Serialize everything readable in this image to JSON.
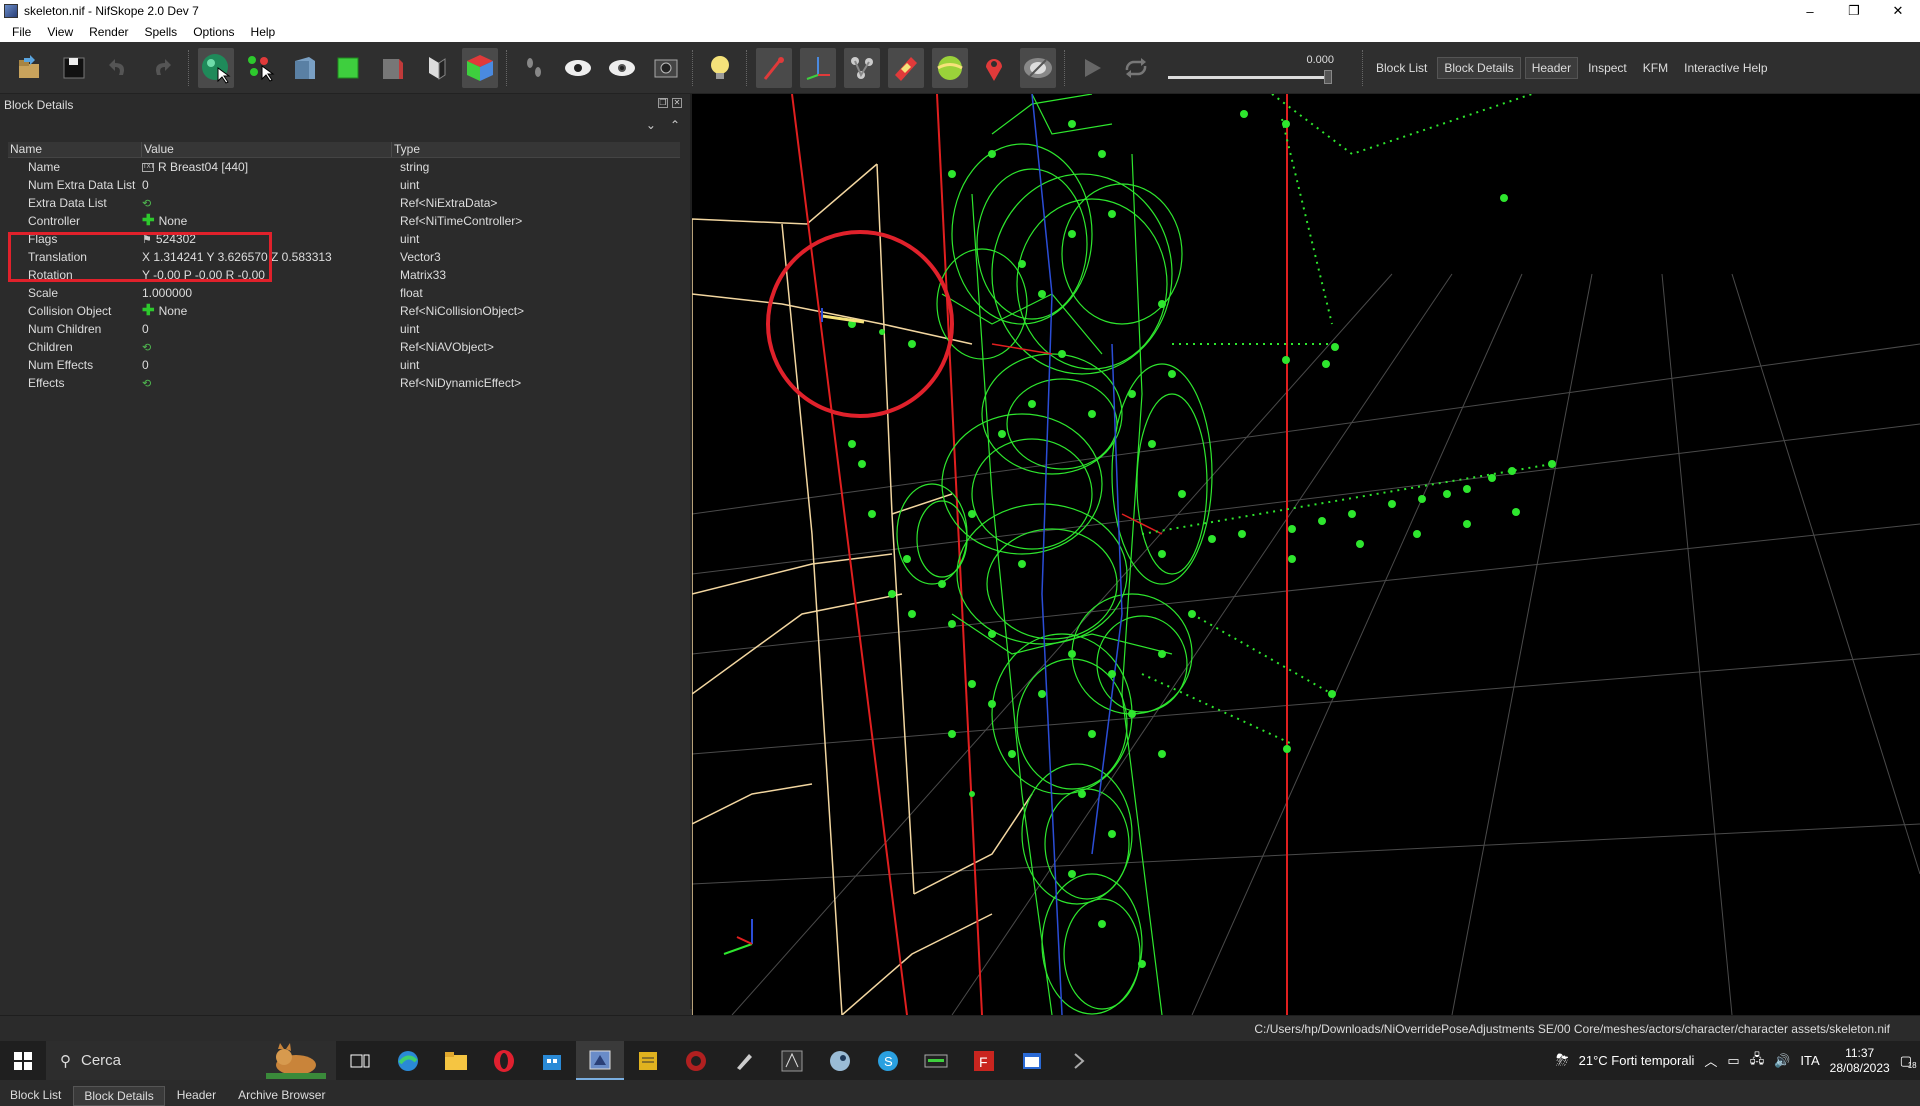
{
  "window": {
    "title": "skeleton.nif - NifSkope 2.0 Dev 7",
    "minimize": "–",
    "maximize": "❐",
    "close": "✕"
  },
  "menu": [
    "File",
    "View",
    "Render",
    "Spells",
    "Options",
    "Help"
  ],
  "toolbar": {
    "slider_value": "0.000",
    "panels": [
      "Block List",
      "Block Details",
      "Header",
      "Inspect",
      "KFM",
      "Interactive Help"
    ]
  },
  "dock": {
    "title": "Block Details",
    "columns": [
      "Name",
      "Value",
      "Type"
    ],
    "rows": [
      {
        "name": "Name",
        "value": "R Breast04 [440]",
        "type": "string",
        "icon": "text-icon"
      },
      {
        "name": "Num Extra Data List",
        "value": "0",
        "type": "uint",
        "icon": ""
      },
      {
        "name": "Extra Data List",
        "value": "",
        "type": "Ref<NiExtraData>",
        "icon": "link-icon"
      },
      {
        "name": "Controller",
        "value": "None",
        "type": "Ref<NiTimeController>",
        "icon": "plus-icon"
      },
      {
        "name": "Flags",
        "value": "524302",
        "type": "uint",
        "icon": "flags-icon"
      },
      {
        "name": "Translation",
        "value": "X 1.314241 Y 3.626570 Z 0.583313",
        "type": "Vector3",
        "icon": ""
      },
      {
        "name": "Rotation",
        "value": "Y -0.00 P -0.00 R -0.00",
        "type": "Matrix33",
        "icon": ""
      },
      {
        "name": "Scale",
        "value": "1.000000",
        "type": "float",
        "icon": ""
      },
      {
        "name": "Collision Object",
        "value": "None",
        "type": "Ref<NiCollisionObject>",
        "icon": "plus-icon"
      },
      {
        "name": "Num Children",
        "value": "0",
        "type": "uint",
        "icon": ""
      },
      {
        "name": "Children",
        "value": "",
        "type": "Ref<NiAVObject>",
        "icon": "link-icon"
      },
      {
        "name": "Num Effects",
        "value": "0",
        "type": "uint",
        "icon": ""
      },
      {
        "name": "Effects",
        "value": "",
        "type": "Ref<NiDynamicEffect>",
        "icon": "link-icon"
      }
    ],
    "tabs": [
      "Block List",
      "Block Details",
      "Header",
      "Archive Browser"
    ],
    "active_tab": "Block Details"
  },
  "status": {
    "path": "C:/Users/hp/Downloads/NiOverridePoseAdjustments SE/00 Core/meshes/actors/character/character assets/skeleton.nif"
  },
  "taskbar": {
    "search_placeholder": "Cerca",
    "weather": "21°C  Forti temporali",
    "lang": "ITA",
    "time": "11:37",
    "date": "28/08/2023",
    "notifications": "18"
  },
  "colors": {
    "wire": "#2ee62e",
    "axis_red": "#e01f1f",
    "grid": "#555555",
    "bbox": "#f2d6a0",
    "highlight": "#e0212b"
  }
}
